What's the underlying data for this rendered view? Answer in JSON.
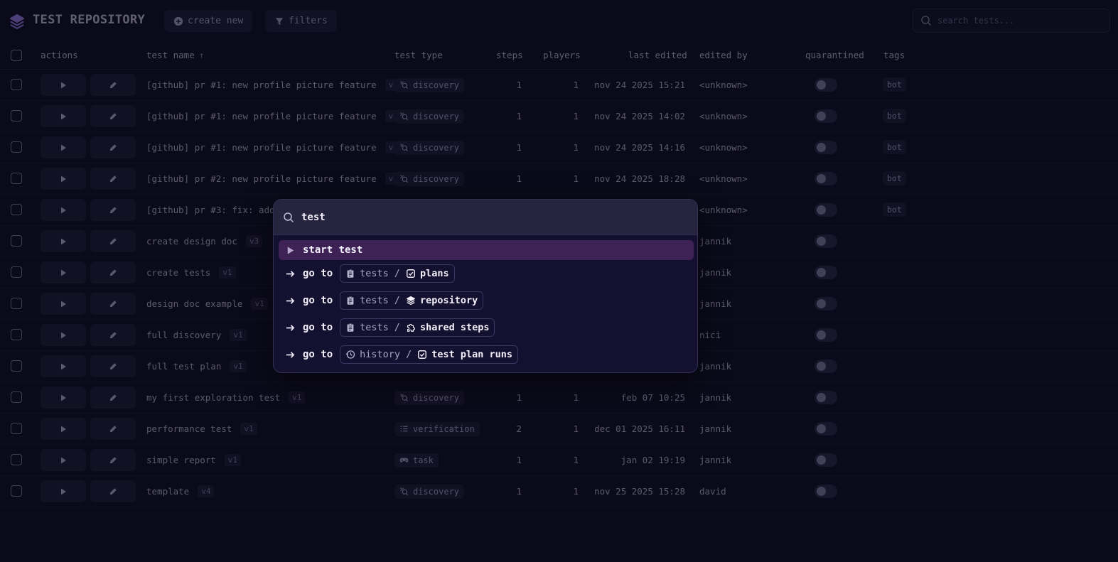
{
  "header": {
    "title": "TEST REPOSITORY",
    "create_label": "create new",
    "filters_label": "filters",
    "search_placeholder": "search tests..."
  },
  "columns": {
    "actions": "actions",
    "test_name": "test name",
    "test_type": "test type",
    "steps": "steps",
    "players": "players",
    "last_edited": "last edited",
    "edited_by": "edited by",
    "quarantined": "quarantined",
    "tags": "tags"
  },
  "rows": [
    {
      "name": "[github] pr #1: new profile picture feature",
      "version": "v1",
      "type": "discovery",
      "steps": "1",
      "players": "1",
      "last_edited": "nov 24 2025 15:21",
      "edited_by": "<unknown>",
      "tag": "bot"
    },
    {
      "name": "[github] pr #1: new profile picture feature",
      "version": "v1",
      "type": "discovery",
      "steps": "1",
      "players": "1",
      "last_edited": "nov 24 2025 14:02",
      "edited_by": "<unknown>",
      "tag": "bot"
    },
    {
      "name": "[github] pr #1: new profile picture feature",
      "version": "v1",
      "type": "discovery",
      "steps": "1",
      "players": "1",
      "last_edited": "nov 24 2025 14:16",
      "edited_by": "<unknown>",
      "tag": "bot"
    },
    {
      "name": "[github] pr #2: new profile picture feature",
      "version": "v1",
      "type": "discovery",
      "steps": "1",
      "players": "1",
      "last_edited": "nov 24 2025 18:28",
      "edited_by": "<unknown>",
      "tag": "bot"
    },
    {
      "name": "[github] pr #3: fix: add",
      "version": "",
      "type": "",
      "steps": "",
      "players": "",
      "last_edited": "",
      "edited_by": "<unknown>",
      "tag": "bot"
    },
    {
      "name": "create design doc",
      "version": "v3",
      "type": "",
      "steps": "",
      "players": "",
      "last_edited": "",
      "edited_by": "jannik",
      "tag": ""
    },
    {
      "name": "create tests",
      "version": "v1",
      "type": "",
      "steps": "",
      "players": "",
      "last_edited": "",
      "edited_by": "jannik",
      "tag": ""
    },
    {
      "name": "design doc example",
      "version": "v1",
      "type": "",
      "steps": "",
      "players": "",
      "last_edited": "",
      "edited_by": "jannik",
      "tag": ""
    },
    {
      "name": "full discovery",
      "version": "v1",
      "type": "",
      "steps": "",
      "players": "",
      "last_edited": "",
      "edited_by": "nici",
      "tag": ""
    },
    {
      "name": "full test plan",
      "version": "v1",
      "type": "",
      "steps": "",
      "players": "",
      "last_edited": "",
      "edited_by": "jannik",
      "tag": ""
    },
    {
      "name": "my first exploration test",
      "version": "v1",
      "type": "discovery",
      "steps": "1",
      "players": "1",
      "last_edited": "feb 07 10:25",
      "edited_by": "jannik",
      "tag": ""
    },
    {
      "name": "performance test",
      "version": "v1",
      "type": "verification",
      "steps": "2",
      "players": "1",
      "last_edited": "dec 01 2025 16:11",
      "edited_by": "jannik",
      "tag": ""
    },
    {
      "name": "simple report",
      "version": "v1",
      "type": "task",
      "steps": "1",
      "players": "1",
      "last_edited": "jan 02 19:19",
      "edited_by": "jannik",
      "tag": ""
    },
    {
      "name": "template",
      "version": "v4",
      "type": "discovery",
      "steps": "1",
      "players": "1",
      "last_edited": "nov 25 2025 15:28",
      "edited_by": "david",
      "tag": ""
    }
  ],
  "palette": {
    "query": "test",
    "items": [
      {
        "label": "start test"
      },
      {
        "label": "go to",
        "crumb_parent": "tests",
        "crumb_child": "plans"
      },
      {
        "label": "go to",
        "crumb_parent": "tests",
        "crumb_child": "repository"
      },
      {
        "label": "go to",
        "crumb_parent": "tests",
        "crumb_child": "shared steps"
      },
      {
        "label": "go to",
        "crumb_parent": "history",
        "crumb_child": "test plan runs"
      }
    ]
  }
}
